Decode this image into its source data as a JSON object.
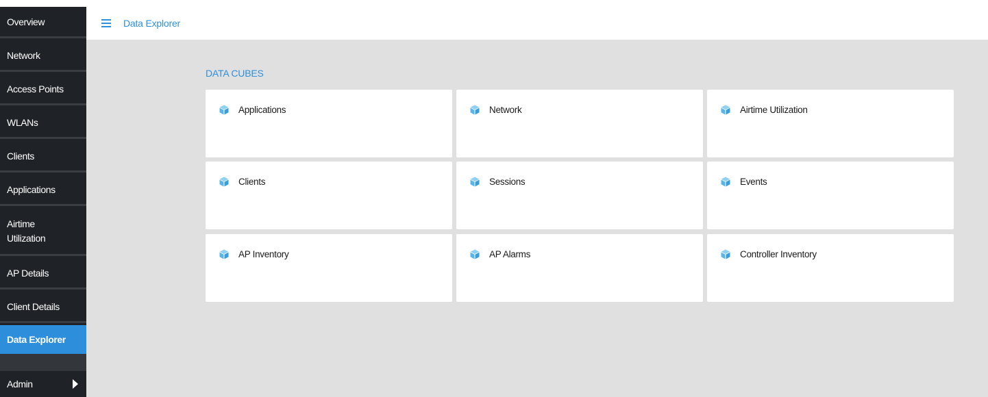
{
  "sidebar": {
    "items": [
      {
        "label": "Overview"
      },
      {
        "label": "Network"
      },
      {
        "label": "Access Points"
      },
      {
        "label": "WLANs"
      },
      {
        "label": "Clients"
      },
      {
        "label": "Applications"
      },
      {
        "label_line1": "Airtime",
        "label_line2": "Utilization"
      },
      {
        "label": "AP Details"
      },
      {
        "label": "Client Details"
      },
      {
        "label": "Data Explorer",
        "active": true
      },
      {
        "label": "Admin"
      }
    ]
  },
  "header": {
    "title": "Data Explorer",
    "menu_icon": "hamburger-menu-icon"
  },
  "main": {
    "section_title": "DATA CUBES",
    "cube_icon": "cube-icon",
    "cubes": [
      {
        "label": "Applications"
      },
      {
        "label": "Network"
      },
      {
        "label": "Airtime Utilization"
      },
      {
        "label": "Clients"
      },
      {
        "label": "Sessions"
      },
      {
        "label": "Events"
      },
      {
        "label": "AP Inventory"
      },
      {
        "label": "AP Alarms"
      },
      {
        "label": "Controller Inventory"
      }
    ]
  },
  "colors": {
    "accent": "#2d8fdb",
    "sidebar_bg": "#1f2327",
    "content_bg": "#e0e0e0",
    "card_bg": "#ffffff",
    "icon": "#5bb6e8"
  }
}
